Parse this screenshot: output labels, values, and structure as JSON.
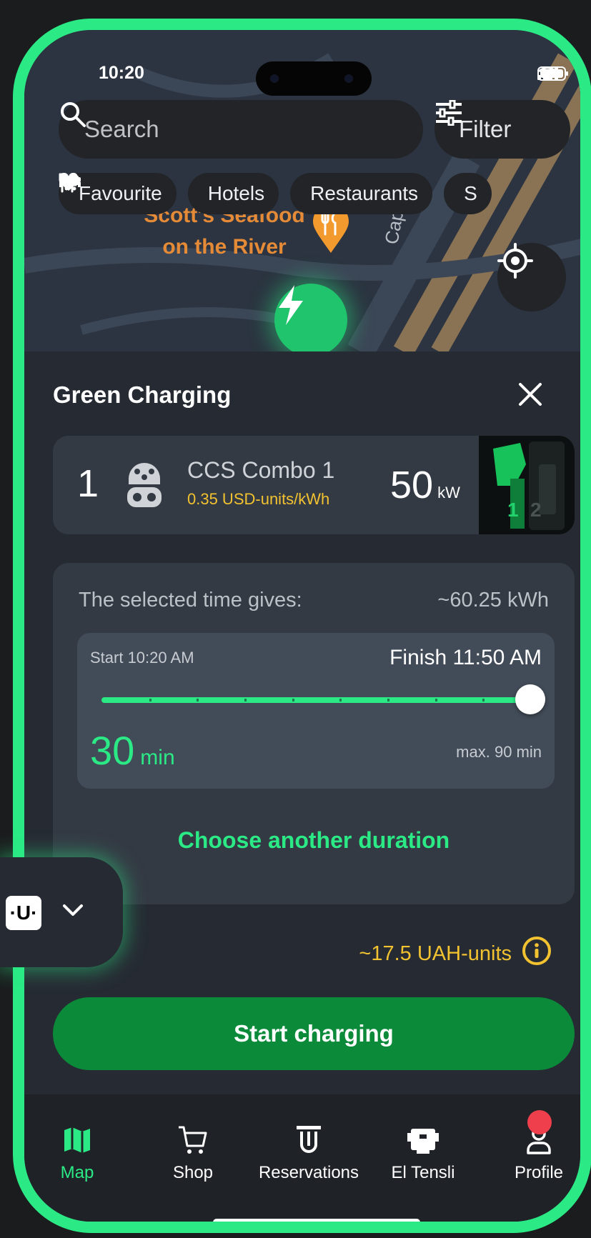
{
  "status_bar": {
    "time": "10:20"
  },
  "search": {
    "placeholder": "Search",
    "icon": "search-icon"
  },
  "filter": {
    "label": "Filter",
    "icon": "sliders-icon"
  },
  "chips": [
    {
      "label": "Favourite",
      "icon": "heart-icon"
    },
    {
      "label": "Hotels",
      "icon": "bed-icon"
    },
    {
      "label": "Restaurants",
      "icon": "fork-knife-icon"
    },
    {
      "label": "S",
      "icon": "cart-icon"
    }
  ],
  "map": {
    "poi_line1": "Scott's Seafood",
    "poi_line2": "on the River",
    "street_label": "Capta"
  },
  "station": {
    "title": "Green Charging",
    "connector": {
      "number": "1",
      "type": "CCS Combo 1",
      "price": "0.35 USD-units/kWh",
      "power": "50",
      "power_unit": "kW",
      "photo_labels": [
        "1",
        "2"
      ]
    }
  },
  "duration": {
    "gives_label": "The selected time gives:",
    "energy": "~60.25 kWh",
    "start": "Start 10:20 AM",
    "finish": "Finish 11:50 AM",
    "slider_fraction": 1.0,
    "minutes": "30",
    "minutes_unit": "min",
    "max": "max. 90 min",
    "choose_link": "Choose another duration"
  },
  "cost": {
    "amount": "~17.5 UAH-units"
  },
  "start_button": {
    "label": "Start charging"
  },
  "widget": {
    "logo_text": "·U·"
  },
  "tabs": [
    {
      "label": "Map",
      "icon": "map-icon",
      "active": true
    },
    {
      "label": "Shop",
      "icon": "cart-icon"
    },
    {
      "label": "Reservations",
      "icon": "reservations-icon"
    },
    {
      "label": "El Tensli",
      "icon": "robot-icon"
    },
    {
      "label": "Profile",
      "icon": "person-icon",
      "badge": true
    }
  ],
  "colors": {
    "accent": "#2bea86",
    "price": "#f2c230",
    "button": "#0b8a3a",
    "badge": "#ef3f4c"
  }
}
